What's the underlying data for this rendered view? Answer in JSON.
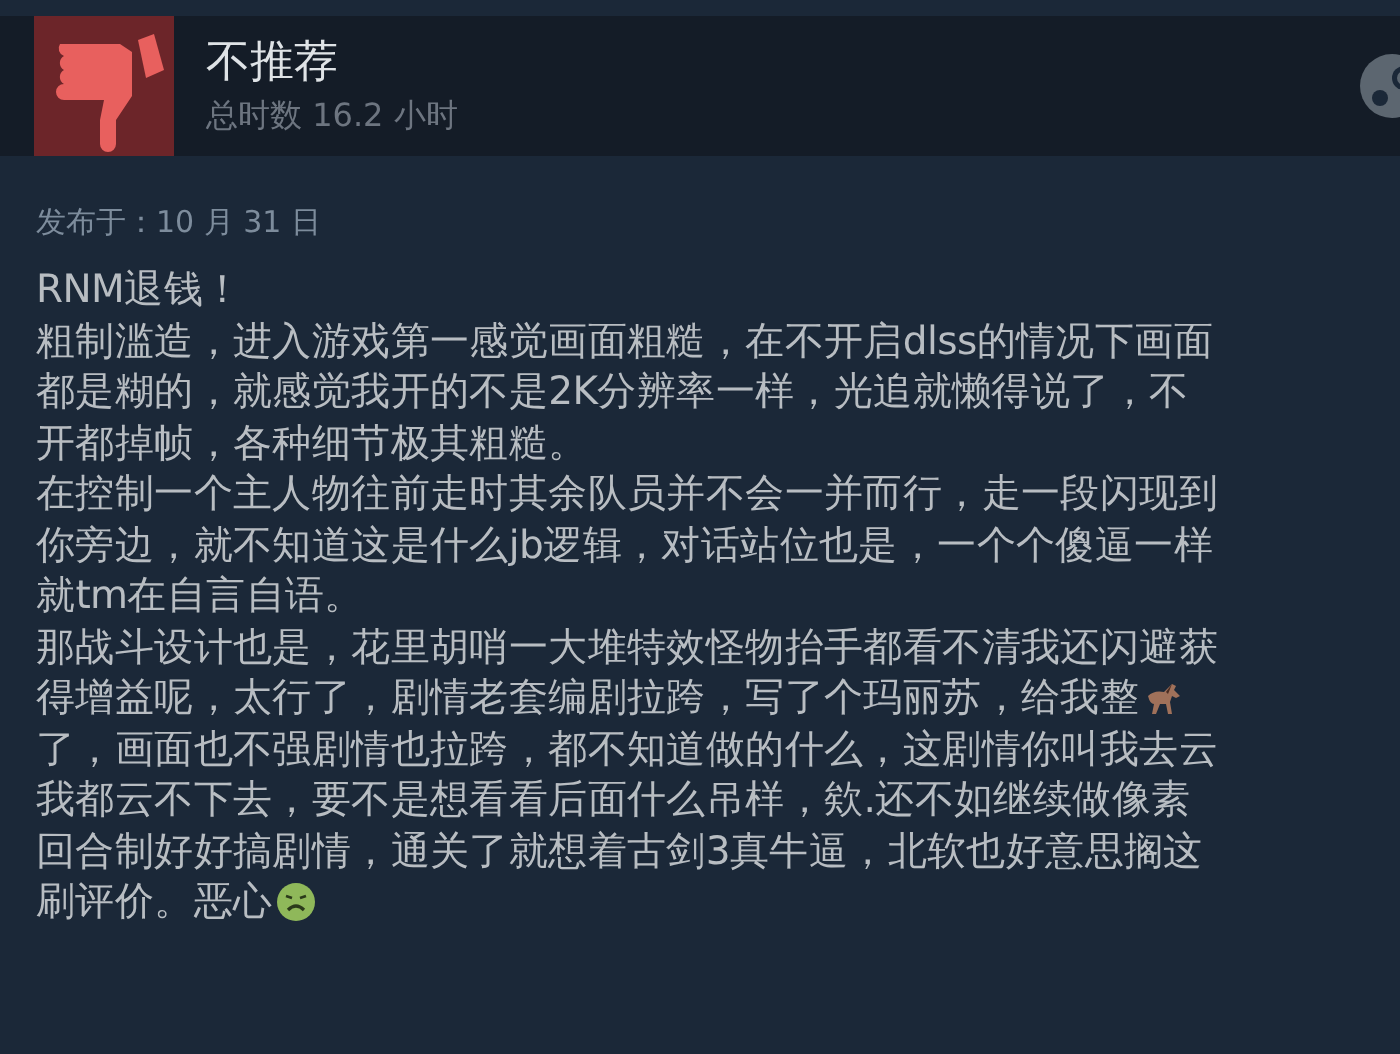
{
  "review": {
    "verdict": "不推荐",
    "recommended": false,
    "hours": "总时数 16.2 小时",
    "posted": "发布于：10 月 31 日",
    "lines": [
      {
        "parts": [
          {
            "kind": "text",
            "text": "RNM退钱！"
          }
        ]
      },
      {
        "parts": [
          {
            "kind": "text",
            "text": "粗制滥造，进入游戏第一感觉画面粗糙，在不开启dlss的情况下画面"
          }
        ]
      },
      {
        "parts": [
          {
            "kind": "text",
            "text": "都是糊的，就感觉我开的不是2K分辨率一样，光追就懒得说了，不"
          }
        ]
      },
      {
        "parts": [
          {
            "kind": "text",
            "text": "开都掉帧，各种细节极其粗糙。"
          }
        ]
      },
      {
        "parts": [
          {
            "kind": "text",
            "text": "在控制一个主人物往前走时其余队员并不会一并而行，走一段闪现到"
          }
        ]
      },
      {
        "parts": [
          {
            "kind": "text",
            "text": "你旁边，就不知道这是什么jb逻辑，对话站位也是，一个个傻逼一样"
          }
        ]
      },
      {
        "parts": [
          {
            "kind": "text",
            "text": "就tm在自言自语。"
          }
        ]
      },
      {
        "parts": [
          {
            "kind": "text",
            "text": "那战斗设计也是，花里胡哨一大堆特效怪物抬手都看不清我还闪避获"
          }
        ]
      },
      {
        "parts": [
          {
            "kind": "text",
            "text": "得增益呢，太行了，剧情老套编剧拉跨，写了个玛丽苏，给我整"
          },
          {
            "kind": "horse"
          }
        ]
      },
      {
        "parts": [
          {
            "kind": "text",
            "text": "了，画面也不强剧情也拉跨，都不知道做的什么，这剧情你叫我去云"
          }
        ]
      },
      {
        "parts": [
          {
            "kind": "text",
            "text": "我都云不下去，要不是想看看后面什么吊样，欸.还不如继续做像素"
          }
        ]
      },
      {
        "parts": [
          {
            "kind": "text",
            "text": "回合制好好搞剧情，通关了就想着古剑3真牛逼，北软也好意思搁这"
          }
        ]
      },
      {
        "parts": [
          {
            "kind": "text",
            "text": "刷评价。恶心"
          },
          {
            "kind": "sick"
          }
        ]
      }
    ]
  }
}
